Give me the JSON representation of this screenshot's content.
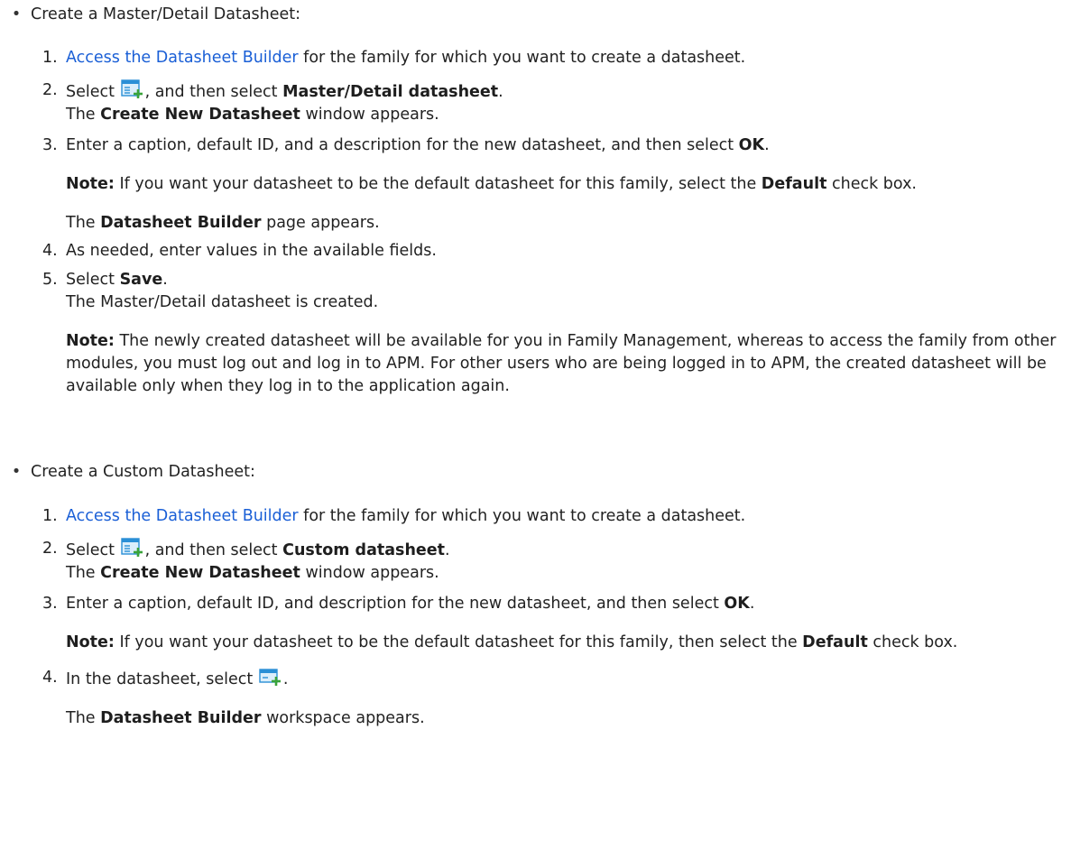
{
  "bullets": [
    {
      "label": "Create a Master/Detail Datasheet:",
      "steps": [
        {
          "num": "1.",
          "link": "Access the Datasheet Builder",
          "rest": " for the family for which you want to create a datasheet."
        },
        {
          "num": "2.",
          "pre": "Select ",
          "post": ", and then select ",
          "bold": "Master/Detail datasheet",
          "end": ".",
          "line2_pre": "The ",
          "line2_bold": "Create New Datasheet",
          "line2_post": " window appears."
        },
        {
          "num": "3.",
          "pre": "Enter a caption, default ID, and a description for the new datasheet, and then select ",
          "bold": "OK",
          "end": ".",
          "note_label": "Note:",
          "note_pre": " If you want your datasheet to be the default datasheet for this family, select the ",
          "note_bold": "Default",
          "note_post": " check box.",
          "result_pre": "The ",
          "result_bold": "Datasheet Builder",
          "result_post": " page appears."
        },
        {
          "num": "4.",
          "text": "As needed, enter values in the available fields."
        },
        {
          "num": "5.",
          "pre": "Select ",
          "bold": "Save",
          "end": ".",
          "line2": "The Master/Detail datasheet is created.",
          "note_label": "Note:",
          "note_text": " The newly created datasheet will be available for you in Family Management, whereas to access the family from other modules, you must log out and log in to APM. For other users who are being logged in to APM, the created datasheet will be available only when they log in to the application again."
        }
      ]
    },
    {
      "label": "Create a Custom Datasheet:",
      "steps": [
        {
          "num": "1.",
          "link": "Access the Datasheet Builder",
          "rest": " for the family for which you want to create a datasheet."
        },
        {
          "num": "2.",
          "pre": "Select ",
          "post": ", and then select ",
          "bold": "Custom datasheet",
          "end": ".",
          "line2_pre": "The ",
          "line2_bold": "Create New Datasheet",
          "line2_post": " window appears."
        },
        {
          "num": "3.",
          "pre": "Enter a caption, default ID, and description for the new datasheet, and then select ",
          "bold": "OK",
          "end": ".",
          "note_label": "Note:",
          "note_pre": " If you want your datasheet to be the default datasheet for this family, then select the ",
          "note_bold": "Default",
          "note_post": " check box."
        },
        {
          "num": "4.",
          "pre": "In the datasheet, select ",
          "end": ".",
          "result_pre": "The ",
          "result_bold": "Datasheet Builder",
          "result_post": " workspace appears."
        }
      ]
    }
  ],
  "icons": {
    "new_datasheet": "new-datasheet-icon",
    "add_section": "add-section-icon"
  },
  "colors": {
    "link": "#1a5fd6",
    "icon_blue": "#2a8fd6",
    "icon_green": "#3aa33a"
  }
}
